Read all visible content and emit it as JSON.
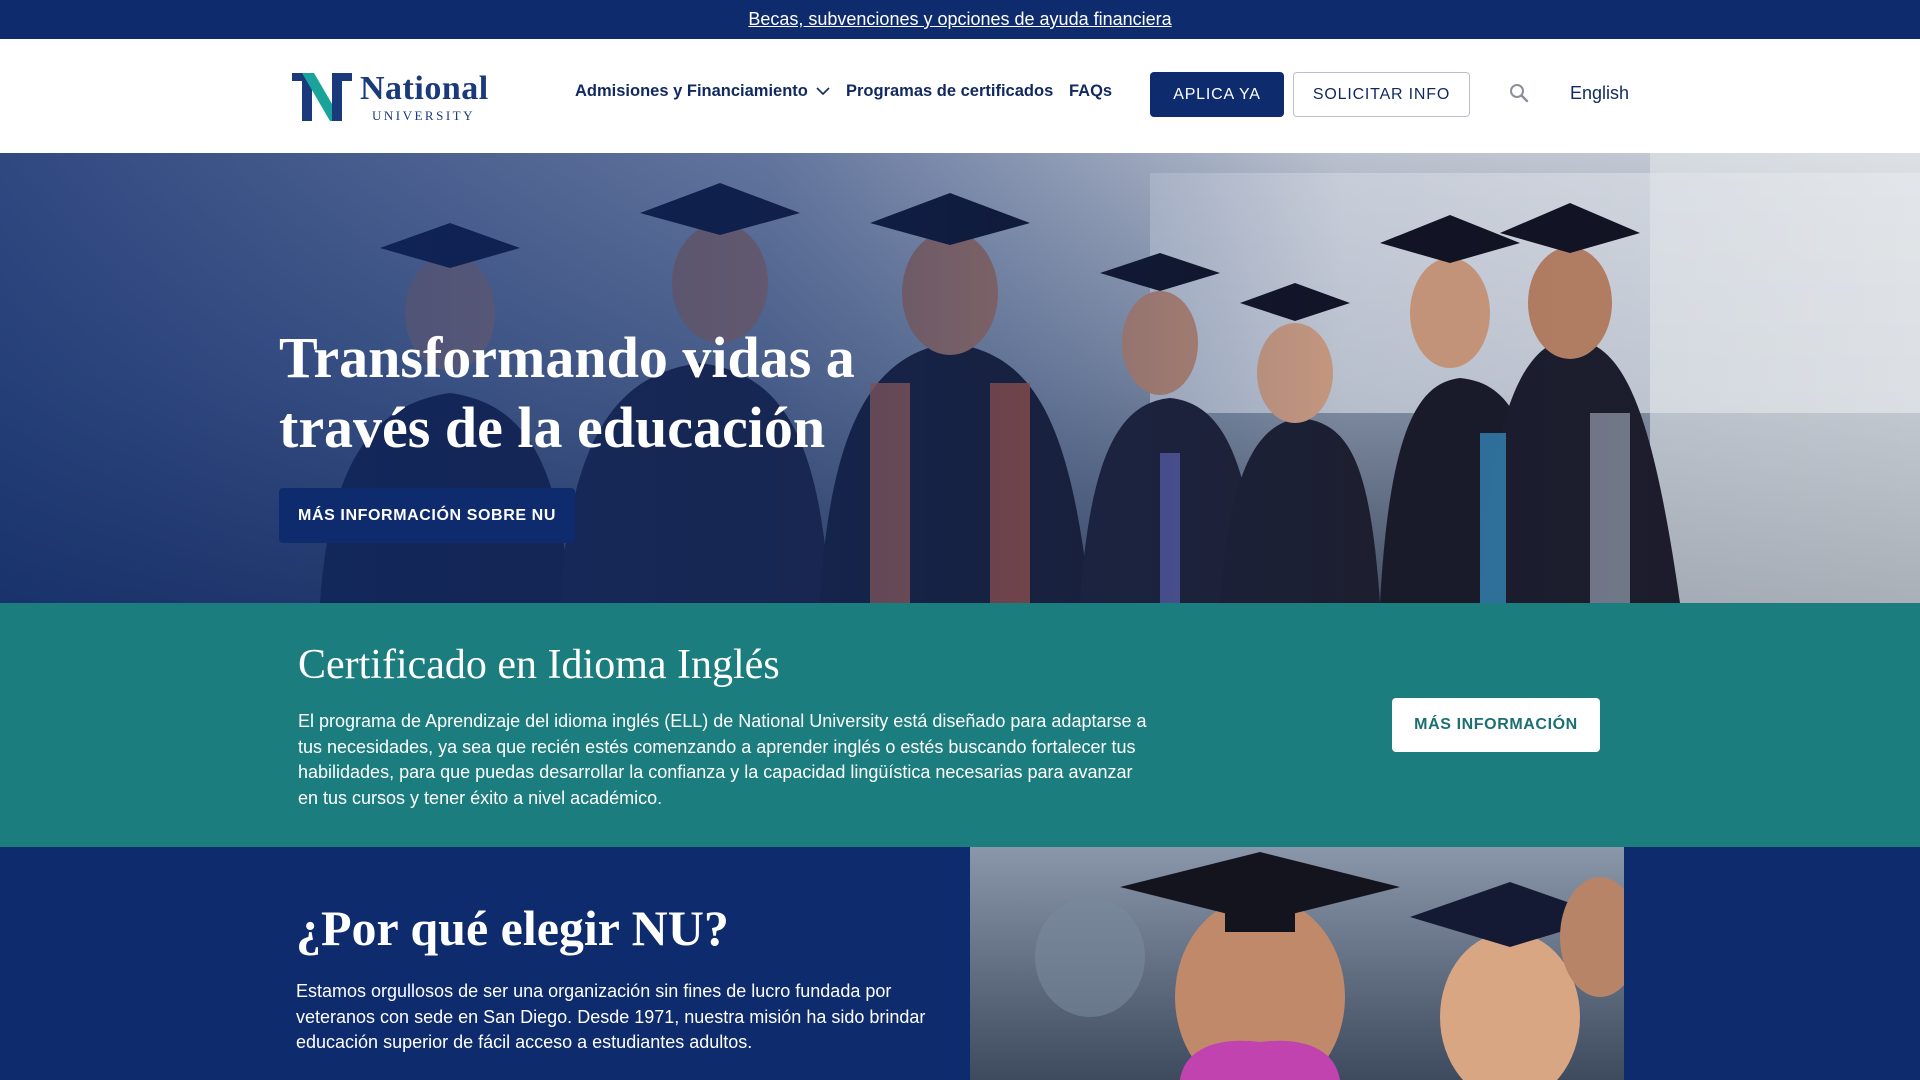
{
  "top_banner": {
    "link_text": "Becas, subvenciones y opciones de ayuda financiera"
  },
  "header": {
    "logo": {
      "name": "National",
      "subtitle": "UNIVERSITY"
    },
    "nav": [
      {
        "label": "Admisiones y Financiamiento",
        "has_dropdown": true
      },
      {
        "label": "Programas de certificados"
      },
      {
        "label": "FAQs"
      }
    ],
    "apply_button": "APLICA YA",
    "info_button": "SOLICITAR INFO",
    "search_icon": "search-icon",
    "language_link": "English"
  },
  "hero": {
    "title": "Transformando vidas a través de la educación",
    "button": "MÁS INFORMACIÓN SOBRE NU"
  },
  "certificate": {
    "title": "Certificado en Idioma Inglés",
    "body": "El programa de Aprendizaje del idioma inglés (ELL) de National University está diseñado para adaptarse a tus necesidades, ya sea que recién estés comenzando a aprender inglés o estés buscando fortalecer tus habilidades, para que puedas desarrollar la confianza y la capacidad lingüística necesarias para avanzar en tus cursos y tener éxito a nivel académico.",
    "button": "MÁS INFORMACIÓN"
  },
  "why": {
    "title": "¿Por qué elegir NU?",
    "body": "Estamos orgullosos de ser una organización sin fines de lucro fundada por veteranos con sede en San Diego. Desde 1971, nuestra misión ha sido brindar educación superior de fácil acceso a estudiantes adultos."
  },
  "colors": {
    "navy": "#0e2b6e",
    "teal": "#1c7d7f",
    "logo_teal": "#1aa39a"
  }
}
